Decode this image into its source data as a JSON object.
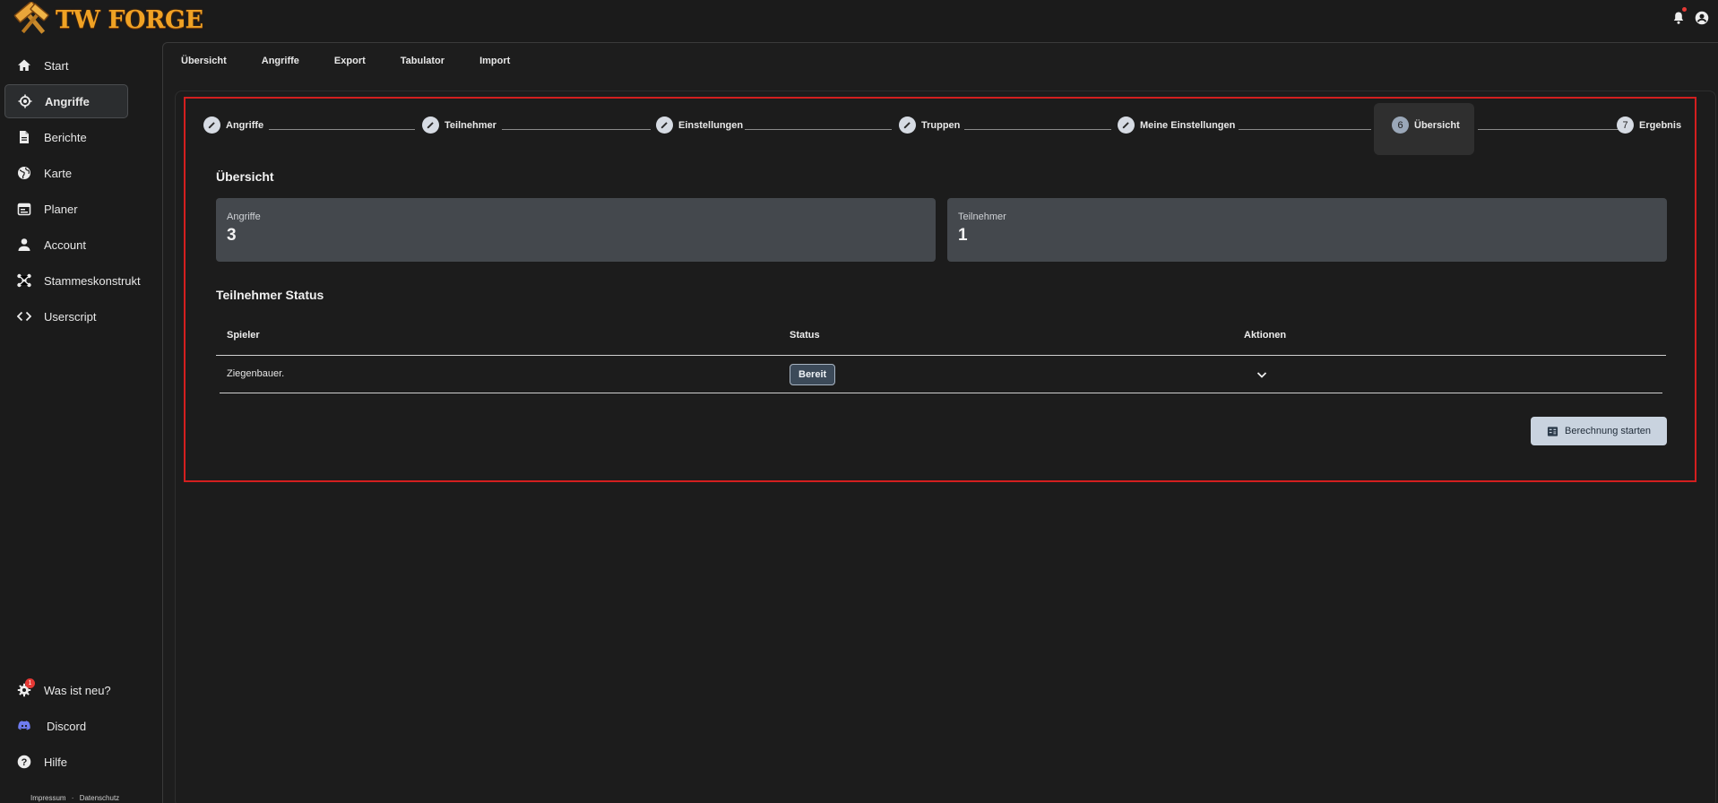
{
  "app": {
    "logo_text": "TW FORGE"
  },
  "sidebar": {
    "items": [
      {
        "label": "Start",
        "icon": "home-icon"
      },
      {
        "label": "Angriffe",
        "icon": "target-icon",
        "active": true
      },
      {
        "label": "Berichte",
        "icon": "document-icon"
      },
      {
        "label": "Karte",
        "icon": "globe-icon"
      },
      {
        "label": "Planer",
        "icon": "calendar-icon"
      },
      {
        "label": "Account",
        "icon": "person-icon"
      },
      {
        "label": "Stammeskonstrukt",
        "icon": "network-icon"
      },
      {
        "label": "Userscript",
        "icon": "code-icon"
      }
    ],
    "bottom": [
      {
        "label": "Was ist neu?",
        "icon": "gear-badge-icon",
        "badge": "1"
      },
      {
        "label": "Discord",
        "icon": "discord-icon"
      },
      {
        "label": "Hilfe",
        "icon": "help-icon"
      }
    ],
    "footer": {
      "impressum": "Impressum",
      "separator": "·",
      "datenschutz": "Datenschutz"
    }
  },
  "tabs": [
    "Übersicht",
    "Angriffe",
    "Export",
    "Tabulator",
    "Import"
  ],
  "stepper": {
    "steps": [
      {
        "label": "Angriffe",
        "marker": "edit"
      },
      {
        "label": "Teilnehmer",
        "marker": "edit"
      },
      {
        "label": "Einstellungen",
        "marker": "edit"
      },
      {
        "label": "Truppen",
        "marker": "edit"
      },
      {
        "label": "Meine Einstellungen",
        "marker": "edit"
      },
      {
        "label": "Übersicht",
        "marker": "6",
        "current": true
      },
      {
        "label": "Ergebnis",
        "marker": "7"
      }
    ]
  },
  "overview": {
    "title": "Übersicht",
    "cards": [
      {
        "label": "Angriffe",
        "value": "3"
      },
      {
        "label": "Teilnehmer",
        "value": "1"
      }
    ]
  },
  "participants": {
    "title": "Teilnehmer Status",
    "headers": {
      "player": "Spieler",
      "status": "Status",
      "actions": "Aktionen"
    },
    "rows": [
      {
        "player": "Ziegenbauer.",
        "status": "Bereit"
      }
    ]
  },
  "actions": {
    "calculate_label": "Berechnung starten"
  },
  "colors": {
    "brand": "#f0a224",
    "highlight_border": "#d31f1f",
    "card_bg": "#44484d",
    "button_bg": "#c9d3df"
  }
}
